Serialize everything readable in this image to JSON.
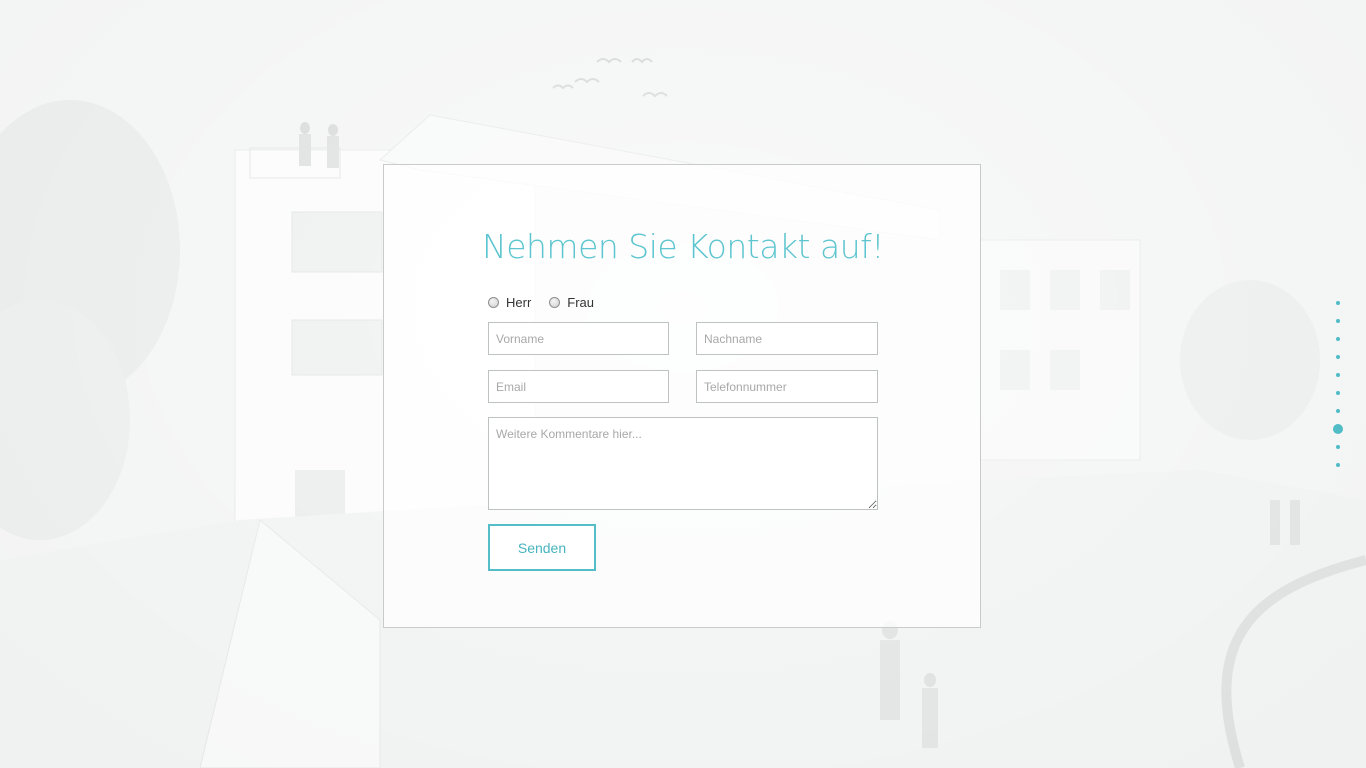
{
  "contact_form": {
    "title": "Nehmen Sie Kontakt auf!",
    "salutation": {
      "options": [
        "Herr",
        "Frau"
      ]
    },
    "fields": {
      "vorname_placeholder": "Vorname",
      "nachname_placeholder": "Nachname",
      "email_placeholder": "Email",
      "telefon_placeholder": "Telefonnummer",
      "kommentar_placeholder": "Weitere Kommentare hier..."
    },
    "submit_label": "Senden"
  },
  "section_nav": {
    "dot_count": 10,
    "active_index": 7
  },
  "colors": {
    "accent": "#5cc5cf",
    "border": "#c9cbcb",
    "background": "#f2f3f3"
  }
}
